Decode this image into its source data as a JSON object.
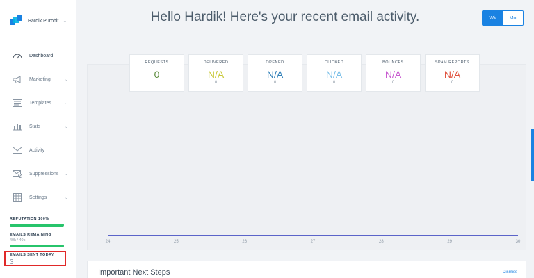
{
  "account": {
    "name": "Hardik Purohit",
    "chevron": "chevron-down-icon"
  },
  "nav": {
    "items": [
      {
        "label": "Dashboard",
        "icon": "dashboard-gauge-icon",
        "chevron": ""
      },
      {
        "label": "Marketing",
        "icon": "megaphone-icon",
        "chevron": "⌄"
      },
      {
        "label": "Templates",
        "icon": "template-icon",
        "chevron": "⌄"
      },
      {
        "label": "Stats",
        "icon": "stats-chart-icon",
        "chevron": "⌄"
      },
      {
        "label": "Activity",
        "icon": "envelope-icon",
        "chevron": ""
      },
      {
        "label": "Suppressions",
        "icon": "suppression-icon",
        "chevron": "⌄"
      },
      {
        "label": "Settings",
        "icon": "settings-grid-icon",
        "chevron": "⌄"
      }
    ]
  },
  "meters": {
    "reputation_label": "REPUTATION 100%",
    "reputation_fraction": 1.0,
    "remaining_label": "EMAILS REMAINING",
    "remaining_value": "40k / 40k",
    "remaining_fraction": 1.0,
    "sent_today_label": "EMAILS SENT TODAY",
    "sent_today_value": "3"
  },
  "header": {
    "title": "Hello Hardik! Here's your recent email activity."
  },
  "toggle": {
    "week": "Wk",
    "month": "Mo"
  },
  "stats": [
    {
      "title": "REQUESTS",
      "value": "0",
      "sub": "",
      "color": "#5a8a3a"
    },
    {
      "title": "DELIVERED",
      "value": "N/A",
      "sub": "0",
      "color": "#c9c93a"
    },
    {
      "title": "OPENED",
      "value": "N/A",
      "sub": "0",
      "color": "#2f7fb8"
    },
    {
      "title": "CLICKED",
      "value": "N/A",
      "sub": "0",
      "color": "#7cc0e8"
    },
    {
      "title": "BOUNCES",
      "value": "N/A",
      "sub": "0",
      "color": "#c85ad0"
    },
    {
      "title": "SPAM REPORTS",
      "value": "N/A",
      "sub": "0",
      "color": "#e0523e"
    }
  ],
  "chart_data": {
    "type": "line",
    "x": [
      "24",
      "25",
      "26",
      "27",
      "28",
      "29",
      "30"
    ],
    "series": [
      {
        "values": [
          0,
          0,
          0,
          0,
          0,
          0,
          0
        ]
      }
    ],
    "line_color": "#5b64c9"
  },
  "next_steps": {
    "title": "Important Next Steps",
    "dismiss": "Dismiss"
  }
}
